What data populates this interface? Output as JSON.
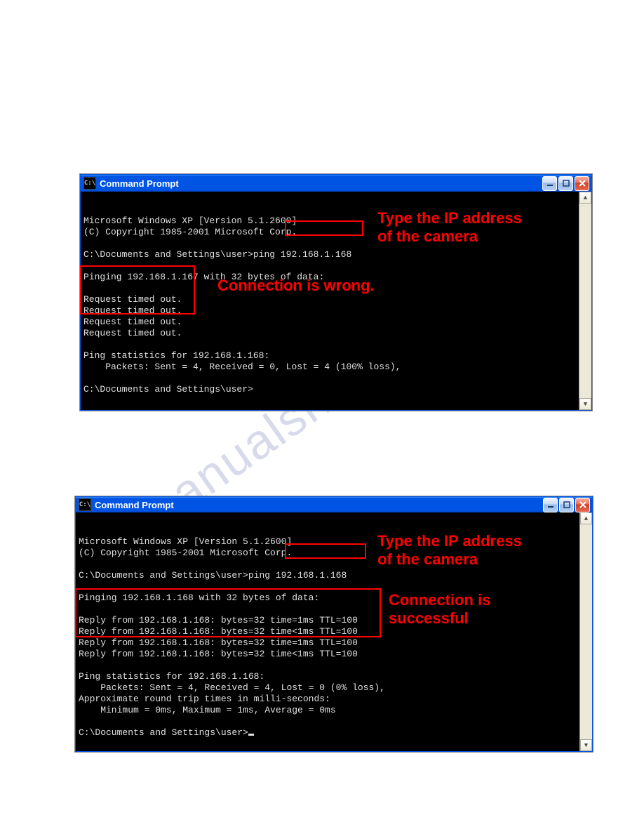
{
  "watermark": "manualshive.com",
  "window1": {
    "title": "Command Prompt",
    "icon_label": "C:\\",
    "lines": {
      "l0": "Microsoft Windows XP [Version 5.1.2600]",
      "l1": "(C) Copyright 1985-2001 Microsoft Corp.",
      "l2": "",
      "prompt1_prefix": "C:\\Documents and Settings\\user>ping ",
      "prompt1_ip": "192.168.1.168",
      "l4": "",
      "l5": "Pinging 192.168.1.167 with 32 bytes of data:",
      "l6": "",
      "r1": "Request timed out.",
      "r2": "Request timed out.",
      "r3": "Request timed out.",
      "r4": "Request timed out.",
      "l11": "",
      "l12": "Ping statistics for 192.168.1.168:",
      "l13": "    Packets: Sent = 4, Received = 0, Lost = 4 (100% loss),",
      "l14": "",
      "prompt2": "C:\\Documents and Settings\\user>"
    },
    "annotations": {
      "ip_label": "Type the IP address\nof the camera",
      "status": "Connection is wrong."
    }
  },
  "window2": {
    "title": "Command Prompt",
    "icon_label": "C:\\",
    "lines": {
      "l0": "Microsoft Windows XP [Version 5.1.2600]",
      "l1": "(C) Copyright 1985-2001 Microsoft Corp.",
      "l2": "",
      "prompt1_prefix": "C:\\Documents and Settings\\user>ping ",
      "prompt1_ip": "192.168.1.168",
      "l4": "",
      "l5": "Pinging 192.168.1.168 with 32 bytes of data:",
      "l6": "",
      "r1": "Reply from 192.168.1.168: bytes=32 time=1ms TTL=100",
      "r2": "Reply from 192.168.1.168: bytes=32 time<1ms TTL=100",
      "r3": "Reply from 192.168.1.168: bytes=32 time=1ms TTL=100",
      "r4": "Reply from 192.168.1.168: bytes=32 time<1ms TTL=100",
      "l11": "",
      "l12": "Ping statistics for 192.168.1.168:",
      "l13": "    Packets: Sent = 4, Received = 4, Lost = 0 (0% loss),",
      "l14": "Approximate round trip times in milli-seconds:",
      "l15": "    Minimum = 0ms, Maximum = 1ms, Average = 0ms",
      "l16": "",
      "prompt2": "C:\\Documents and Settings\\user>"
    },
    "annotations": {
      "ip_label": "Type the IP address\nof the camera",
      "status": "Connection is\nsuccessful"
    }
  }
}
